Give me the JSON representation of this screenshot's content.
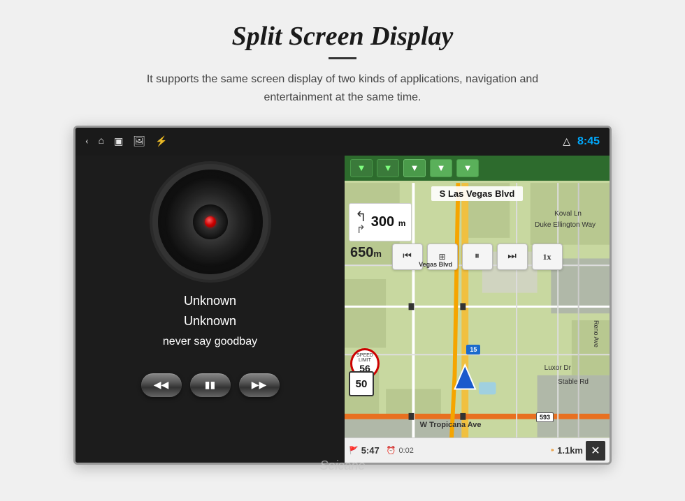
{
  "page": {
    "title": "Split Screen Display",
    "subtitle": "It supports the same screen display of two kinds of applications, navigation and entertainment at the same time."
  },
  "statusbar": {
    "time": "8:45",
    "icons": [
      "back",
      "home",
      "window",
      "image",
      "usb"
    ]
  },
  "music": {
    "artist": "Unknown",
    "album": "Unknown",
    "song": "never say goodbay",
    "controls": {
      "prev": "⏮",
      "pause": "⏸",
      "next": "⏭"
    }
  },
  "nav": {
    "header_arrows": [
      "▼",
      "▼",
      "▼",
      "▼",
      "▼"
    ],
    "street": "S Las Vegas Blvd",
    "koval": "Koval Ln",
    "duke": "Duke Ellington Way",
    "luxor": "Luxor Dr",
    "stable": "Stable Rd",
    "tropicana": "W Tropicana Ave",
    "turn_distance": "300",
    "turn_unit": "m",
    "dist_ahead": "650",
    "dist_unit": "m",
    "speed_limit": "56",
    "speed_current": "50",
    "i15": "15",
    "rt593": "593",
    "controls": [
      "⏮",
      "⊞",
      "⏸",
      "⏭",
      "1x"
    ],
    "bottom": {
      "time1": "5:47",
      "time2": "0:02",
      "dist": "1.1km"
    }
  },
  "watermark": "Seicane"
}
